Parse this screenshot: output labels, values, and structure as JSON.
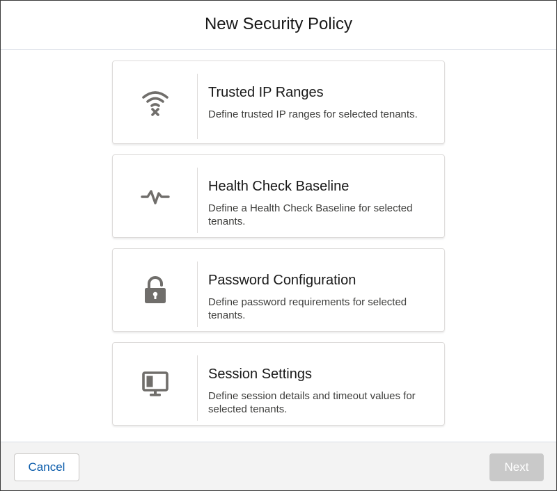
{
  "modal": {
    "title": "New Security Policy"
  },
  "options": [
    {
      "title": "Trusted IP Ranges",
      "description": "Define trusted IP ranges for selected tenants.",
      "icon": "wifi-off-icon"
    },
    {
      "title": "Health Check Baseline",
      "description": "Define a Health Check Baseline for selected tenants.",
      "icon": "pulse-icon"
    },
    {
      "title": "Password Configuration",
      "description": "Define password requirements for selected tenants.",
      "icon": "unlock-icon"
    },
    {
      "title": "Session Settings",
      "description": "Define session details and timeout values for selected tenants.",
      "icon": "monitor-icon"
    }
  ],
  "footer": {
    "cancel_label": "Cancel",
    "next_label": "Next",
    "next_disabled": true
  },
  "colors": {
    "accent": "#0b5cab",
    "icon": "#706e6b",
    "disabled_button": "#c9c9c9",
    "footer_bg": "#f3f3f3"
  }
}
